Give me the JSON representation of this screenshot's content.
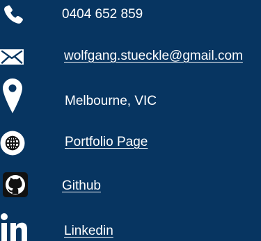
{
  "contact": {
    "phone": {
      "icon": "phone-icon",
      "text": "0404 652 859"
    },
    "email": {
      "icon": "envelope-icon",
      "text": "wolfgang.stueckle@gmail.com"
    },
    "location": {
      "icon": "map-pin-icon",
      "text": "Melbourne, VIC"
    },
    "portfolio": {
      "icon": "globe-icon",
      "text": "Portfolio Page"
    },
    "github": {
      "icon": "github-icon",
      "text": "Github"
    },
    "linkedin": {
      "icon": "linkedin-icon",
      "text": "Linkedin"
    }
  },
  "colors": {
    "background": "#073561",
    "text": "#ffffff"
  }
}
